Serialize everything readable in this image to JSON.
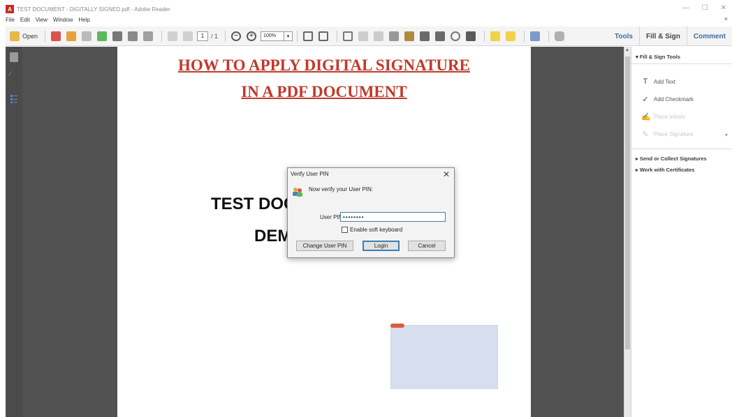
{
  "window": {
    "title": "TEST DOCUMENT - DIGITALLY SIGNED.pdf - Adobe Reader",
    "app_icon_label": "A",
    "minimize": "—",
    "maximize": "☐",
    "close": "✕"
  },
  "menu": {
    "items": [
      "File",
      "Edit",
      "View",
      "Window",
      "Help"
    ],
    "close_doc": "×"
  },
  "toolbar": {
    "open_label": "Open",
    "page_current": "1",
    "page_total": "/ 1",
    "zoom_value": "100%",
    "zoom_dropdown": "▾",
    "zoom_out": "−",
    "zoom_in": "+",
    "nav_tabs": [
      {
        "label": "Tools"
      },
      {
        "label": "Fill & Sign"
      },
      {
        "label": "Comment"
      }
    ]
  },
  "document": {
    "title_line1": "HOW TO APPLY DIGITAL SIGNATURE",
    "title_line2": "IN A PDF DOCUMENT",
    "body_line1": "TEST DOC",
    "body_line2": "DEM"
  },
  "dialog": {
    "title": "Verify User PIN",
    "close": "✕",
    "message": "Now verify your User PIN:",
    "pin_label": "User PIN:",
    "pin_value": "••••••••",
    "checkbox_label": "Enable soft keyboard",
    "checkbox_checked": false,
    "btn_change": "Change User PIN",
    "btn_login": "Login",
    "btn_cancel": "Cancel"
  },
  "right_pane": {
    "section_fill_sign": "▾ Fill & Sign Tools",
    "items": [
      {
        "icon": "T",
        "label": "Add Text",
        "disabled": false
      },
      {
        "icon": "✓",
        "label": "Add Checkmark",
        "disabled": false
      },
      {
        "icon": "✍",
        "label": "Place Initials",
        "disabled": true
      },
      {
        "icon": "✎",
        "label": "Place Signature",
        "disabled": true
      }
    ],
    "item_dropdown": "▾",
    "section_send": "▸ Send or Collect Signatures",
    "section_certs": "▸ Work with Certificates"
  },
  "colors": {
    "accent_blue": "#3b6ea8",
    "title_red": "#c0392b",
    "canvas_gray": "#515151",
    "signature_field": "#d7deee"
  }
}
